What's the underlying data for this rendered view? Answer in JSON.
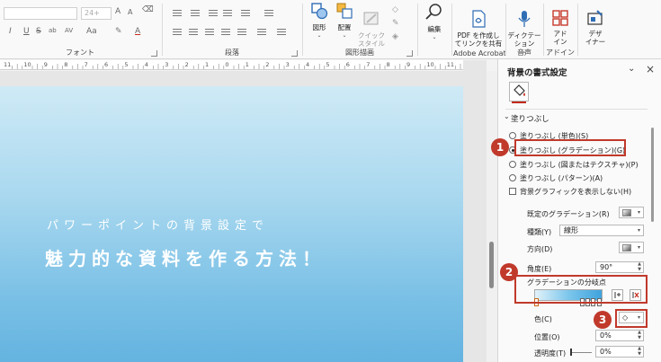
{
  "ribbon": {
    "font_group": "フォント",
    "font_size": "24+",
    "format_buttons": [
      "I",
      "U",
      "S",
      "ab",
      "AV",
      "Aa",
      "A",
      "A"
    ],
    "paragraph_group": "段落",
    "drawing_group": "図形描画",
    "shape_btn": "図形",
    "arrange_btn": "配置",
    "quick_style_btn": "クイック\nスタイル",
    "edit_btn": "編集",
    "pdf_btn": "PDF を作成し\nてリンクを共有",
    "adobe_group": "Adobe Acrobat",
    "dictate_btn": "ディクテー\nション",
    "voice_group": "音声",
    "addin_btn": "アド\nイン",
    "addin_group": "アドイン",
    "designer_btn": "デザ\nイナー"
  },
  "ruler": {
    "labels": [
      "11",
      "10",
      "9",
      "8",
      "7",
      "6",
      "5",
      "4",
      "3",
      "2",
      "1",
      "0",
      "1",
      "2",
      "3",
      "4",
      "5",
      "6",
      "7",
      "8",
      "9",
      "10",
      "11"
    ]
  },
  "slide": {
    "subtitle": "パワーポイントの背景設定で",
    "title": "魅力的な資料を作る方法！"
  },
  "pane": {
    "title": "背景の書式設定",
    "section_fill": "塗りつぶし",
    "options": [
      "塗りつぶし (単色)(S)",
      "塗りつぶし (グラデーション)(G)",
      "塗りつぶし (図またはテクスチャ)(P)",
      "塗りつぶし (パターン)(A)"
    ],
    "hide_bg_graphics": "背景グラフィックを表示しない(H)",
    "preset_label": "既定のグラデーション(R)",
    "type_label": "種類(Y)",
    "type_value": "線形",
    "direction_label": "方向(D)",
    "angle_label": "角度(E)",
    "angle_value": "90°",
    "stops_label": "グラデーションの分岐点",
    "color_label": "色(C)",
    "position_label": "位置(O)",
    "position_value": "0%",
    "transparency_label": "透明度(T)",
    "transparency_value": "0%"
  },
  "annotations": [
    "1",
    "2",
    "3"
  ],
  "colors": {
    "highlight": "#c0392b",
    "accent": "#c42b1c"
  }
}
